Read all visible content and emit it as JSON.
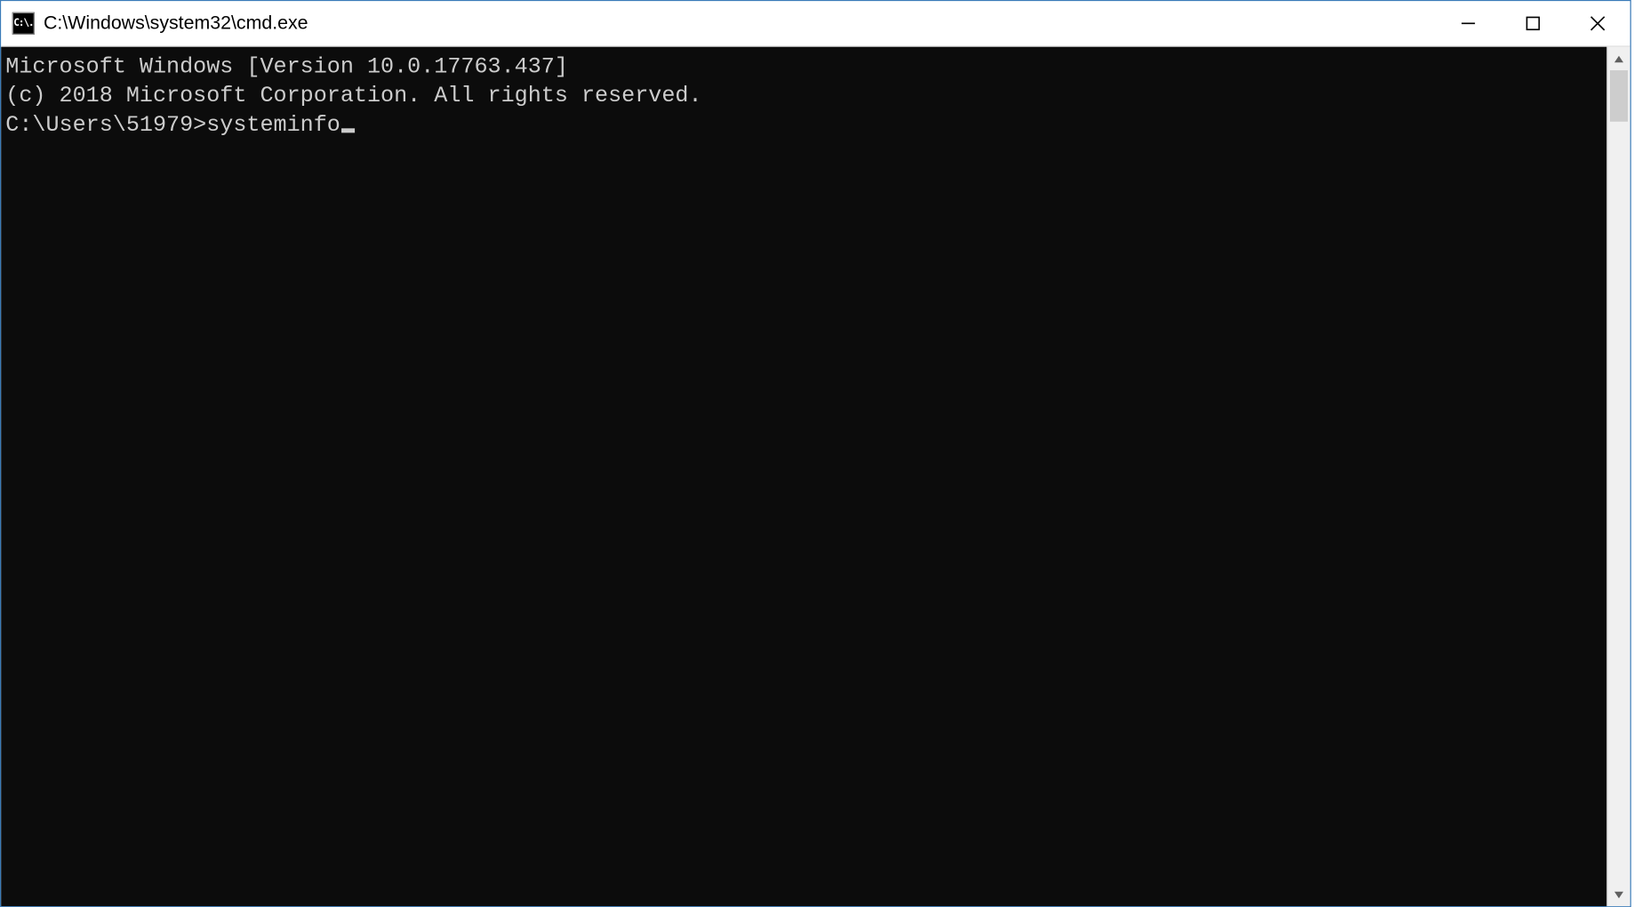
{
  "window": {
    "title": "C:\\Windows\\system32\\cmd.exe",
    "icon_label": "C:\\."
  },
  "terminal": {
    "line1": "Microsoft Windows [Version 10.0.17763.437]",
    "line2": "(c) 2018 Microsoft Corporation. All rights reserved.",
    "blank": "",
    "prompt": "C:\\Users\\51979>",
    "command": "systeminfo"
  }
}
